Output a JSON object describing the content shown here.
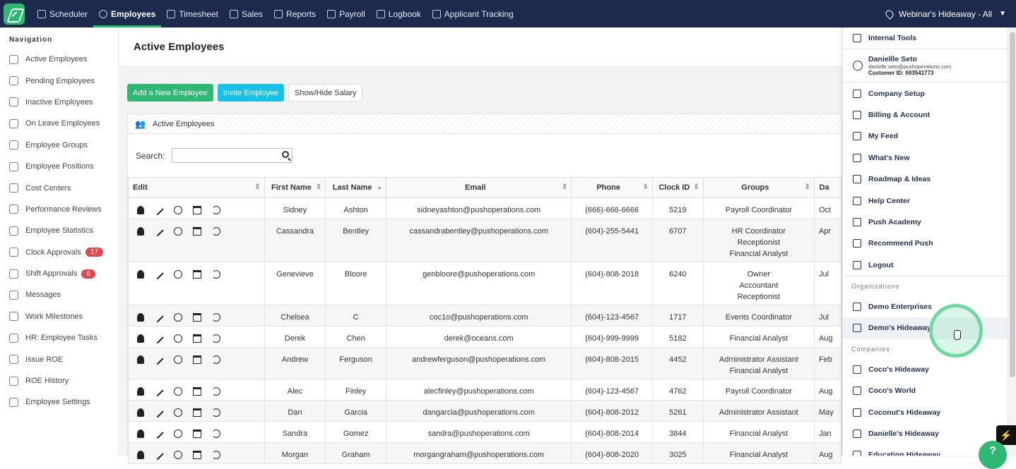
{
  "topnav": {
    "items": [
      {
        "label": "Scheduler",
        "icon": "calendar-icon"
      },
      {
        "label": "Employees",
        "icon": "user-icon",
        "active": true
      },
      {
        "label": "Timesheet",
        "icon": "clock-icon"
      },
      {
        "label": "Sales",
        "icon": "register-icon"
      },
      {
        "label": "Reports",
        "icon": "chart-icon"
      },
      {
        "label": "Payroll",
        "icon": "payroll-icon"
      },
      {
        "label": "Logbook",
        "icon": "book-icon"
      },
      {
        "label": "Applicant Tracking",
        "icon": "clipboard-icon"
      }
    ],
    "location": "Webinar's Hideaway - All",
    "accent": "#2eb873",
    "background": "#1c2a4d"
  },
  "sidebar": {
    "heading": "Navigation",
    "items": [
      {
        "label": "Active Employees"
      },
      {
        "label": "Pending Employees"
      },
      {
        "label": "Inactive Employees"
      },
      {
        "label": "On Leave Employees"
      },
      {
        "label": "Employee Groups"
      },
      {
        "label": "Employee Positions"
      },
      {
        "label": "Cost Centers"
      },
      {
        "label": "Performance Reviews"
      },
      {
        "label": "Employee Statistics"
      },
      {
        "label": "Clock Approvals",
        "badge": "17"
      },
      {
        "label": "Shift Approvals",
        "badge": "6"
      },
      {
        "label": "Messages"
      },
      {
        "label": "Work Milestones"
      },
      {
        "label": "HR: Employee Tasks"
      },
      {
        "label": "Issue ROE"
      },
      {
        "label": "ROE History"
      },
      {
        "label": "Employee Settings"
      }
    ]
  },
  "main": {
    "title": "Active Employees",
    "buttons": {
      "add": "Add a New Employee",
      "invite": "Invite Employee",
      "salary": "Show/Hide Salary"
    },
    "panel_title": "Active Employees",
    "search_label": "Search:"
  },
  "table": {
    "headers": [
      "Edit",
      "First Name",
      "Last Name",
      "Email",
      "Phone",
      "Clock ID",
      "Groups",
      "Da"
    ],
    "rows": [
      {
        "first": "Sidney",
        "last": "Ashton",
        "email": "sidneyashton@pushoperations.com",
        "phone": "(666)-666-6666",
        "clock": "5219",
        "groups": [
          "Payroll Coordinator"
        ],
        "date": "Oct"
      },
      {
        "first": "Cassandra",
        "last": "Bentley",
        "email": "cassandrabentley@pushoperations.com",
        "phone": "(604)-255-5441",
        "clock": "6707",
        "groups": [
          "HR Coordinator",
          "Receptionist",
          "Financial Analyst"
        ],
        "date": "Apr"
      },
      {
        "first": "Genevieve",
        "last": "Bloore",
        "email": "genbloore@pushoperations.com",
        "phone": "(604)-808-2018",
        "clock": "6240",
        "groups": [
          "Owner",
          "Accountant",
          "Receptionist"
        ],
        "date": "Jul"
      },
      {
        "first": "Chelsea",
        "last": "C",
        "email": "coc1o@pushoperations.com",
        "phone": "(604)-123-4567",
        "clock": "1717",
        "groups": [
          "Events Coordinator"
        ],
        "date": "Jul"
      },
      {
        "first": "Derek",
        "last": "Chen",
        "email": "derek@oceans.com",
        "phone": "(604)-999-9999",
        "clock": "5182",
        "groups": [
          "Financial Analyst"
        ],
        "date": "Aug"
      },
      {
        "first": "Andrew",
        "last": "Ferguson",
        "email": "andrewferguson@pushoperations.com",
        "phone": "(604)-808-2015",
        "clock": "4452",
        "groups": [
          "Administrator Assistant",
          "Financial Analyst"
        ],
        "date": "Feb"
      },
      {
        "first": "Alec",
        "last": "Finley",
        "email": "alecfinley@pushoperations.com",
        "phone": "(604)-123-4567",
        "clock": "4762",
        "groups": [
          "Payroll Coordinator"
        ],
        "date": "Aug"
      },
      {
        "first": "Dan",
        "last": "Garcia",
        "email": "dangarcia@pushoperations.com",
        "phone": "(604)-808-2012",
        "clock": "5261",
        "groups": [
          "Administrator Assistant"
        ],
        "date": "May"
      },
      {
        "first": "Sandra",
        "last": "Gomez",
        "email": "sandra@pushoperations.com",
        "phone": "(604)-808-2014",
        "clock": "3844",
        "groups": [
          "Financial Analyst"
        ],
        "date": "Jan"
      },
      {
        "first": "Morgan",
        "last": "Graham",
        "email": "morgangraham@pushoperations.com",
        "phone": "(604)-808-2020",
        "clock": "3025",
        "groups": [
          "Financial Analyst"
        ],
        "date": "Aug"
      }
    ]
  },
  "dropdown": {
    "internal_tools": "Internal Tools",
    "user": {
      "name": "Daniellle Seto",
      "email": "danielle.seto@pushoperations.com",
      "customer_id": "Customer ID: 693541773"
    },
    "menu": [
      {
        "label": "Company Setup",
        "icon": "building-icon"
      },
      {
        "label": "Billing & Account",
        "icon": "invoice-icon"
      },
      {
        "label": "My Feed",
        "icon": "feed-icon"
      },
      {
        "label": "What's New",
        "icon": "news-icon"
      },
      {
        "label": "Roadmap & Ideas",
        "icon": "roadmap-icon"
      },
      {
        "label": "Help Center",
        "icon": "help-icon"
      },
      {
        "label": "Push Academy",
        "icon": "graduation-cap-icon"
      },
      {
        "label": "Recommend Push",
        "icon": "gift-icon"
      },
      {
        "label": "Logout",
        "icon": "logout-icon"
      }
    ],
    "organizations_heading": "Organizations",
    "organizations": [
      {
        "label": "Demo Enterprises"
      },
      {
        "label": "Demo's Hideaway",
        "highlighted": true
      }
    ],
    "companies_heading": "Companies",
    "companies": [
      {
        "label": "Coco's Hideaway"
      },
      {
        "label": "Coco's World"
      },
      {
        "label": "Coconut's Hideaway"
      },
      {
        "label": "Danielle's Hideaway"
      },
      {
        "label": "Education Hideaway"
      }
    ]
  },
  "help_button": "?"
}
